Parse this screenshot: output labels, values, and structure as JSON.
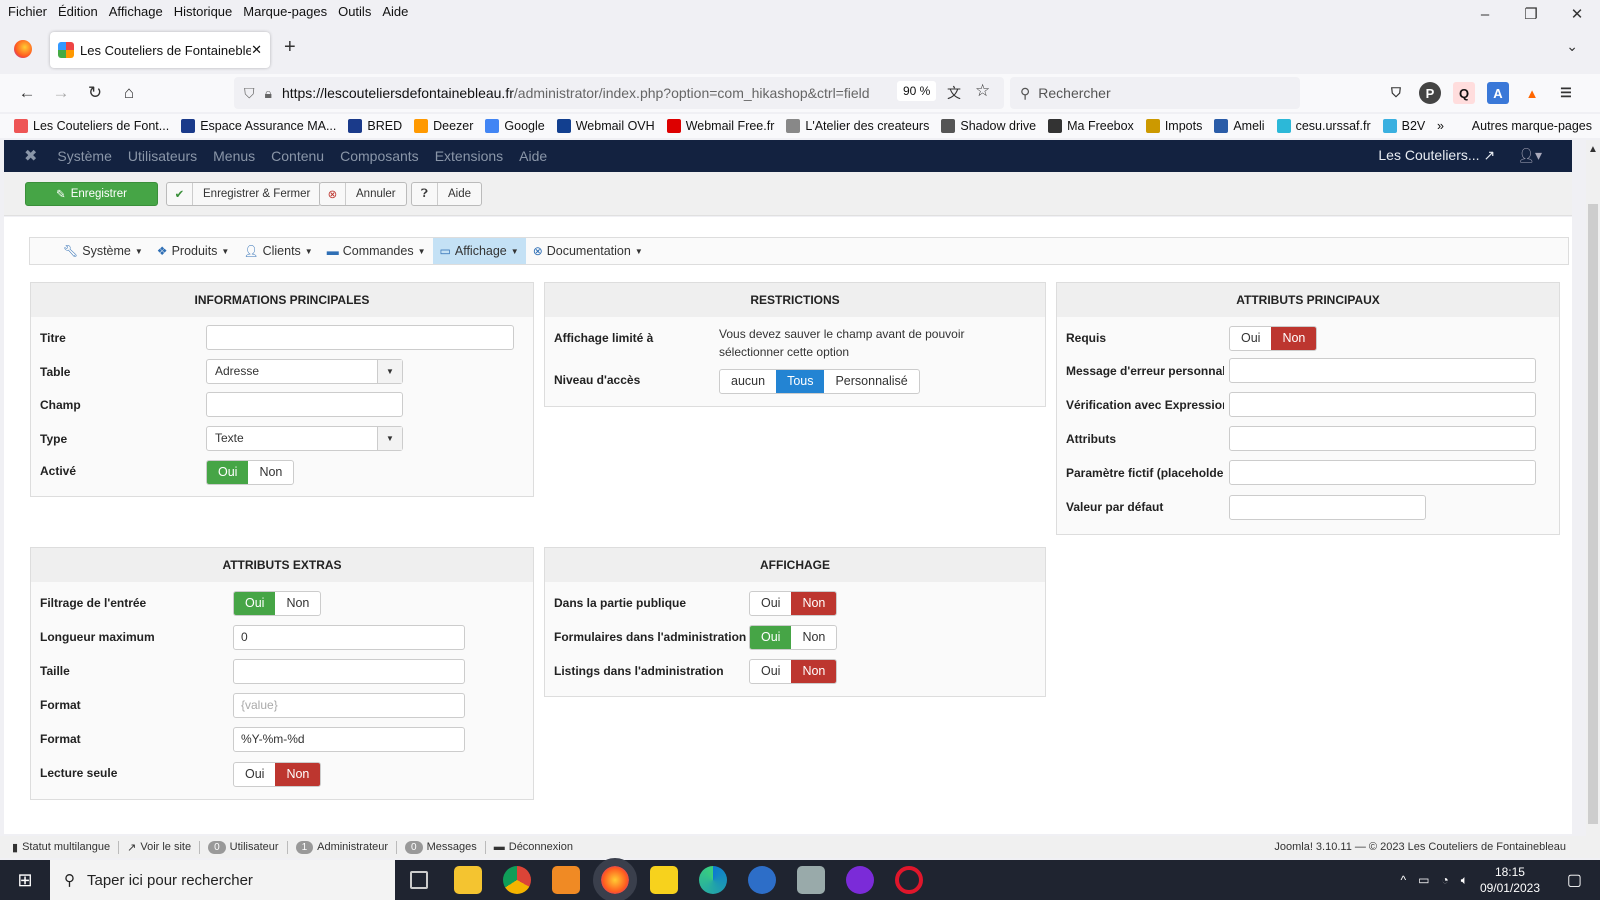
{
  "menubar": [
    "Fichier",
    "Édition",
    "Affichage",
    "Historique",
    "Marque-pages",
    "Outils",
    "Aide"
  ],
  "tab": {
    "title": "Les Couteliers de Fontainebleau"
  },
  "nav": {
    "url_host": "https://lescouteliersdefontainebleau.fr",
    "url_path": "/administrator/index.php?option=com_hikashop&ctrl=field",
    "zoom": "90 %",
    "search_placeholder": "Rechercher"
  },
  "bookmarks": [
    {
      "label": "Les Couteliers de Font...",
      "color": "#e55"
    },
    {
      "label": "Espace Assurance MA...",
      "color": "#1a3a8a"
    },
    {
      "label": "BRED",
      "color": "#1a3a8a"
    },
    {
      "label": "Deezer",
      "color": "#f90"
    },
    {
      "label": "Google",
      "color": "#4285f4"
    },
    {
      "label": "Webmail OVH",
      "color": "#123f8f"
    },
    {
      "label": "Webmail Free.fr",
      "color": "#d00"
    },
    {
      "label": "L'Atelier des createurs",
      "color": "#888"
    },
    {
      "label": "Shadow drive",
      "color": "#555"
    },
    {
      "label": "Ma Freebox",
      "color": "#333"
    },
    {
      "label": "Impots",
      "color": "#c90"
    },
    {
      "label": "Ameli",
      "color": "#2a5ca8"
    },
    {
      "label": "cesu.urssaf.fr",
      "color": "#2cb8d8"
    },
    {
      "label": "B2V",
      "color": "#3ab0e0"
    }
  ],
  "bookmarks_other": "Autres marque-pages",
  "joomla_menu": [
    "Système",
    "Utilisateurs",
    "Menus",
    "Contenu",
    "Composants",
    "Extensions",
    "Aide"
  ],
  "joomla_site": "Les Couteliers...",
  "toolbar": {
    "save": "Enregistrer",
    "save_close": "Enregistrer & Fermer",
    "cancel": "Annuler",
    "help": "Aide"
  },
  "submenu": [
    {
      "label": "Système",
      "icon": "wrench-icon"
    },
    {
      "label": "Produits",
      "icon": "cubes-icon"
    },
    {
      "label": "Clients",
      "icon": "user-icon"
    },
    {
      "label": "Commandes",
      "icon": "credit-card-icon"
    },
    {
      "label": "Affichage",
      "icon": "monitor-icon"
    },
    {
      "label": "Documentation",
      "icon": "lifebuoy-icon"
    }
  ],
  "info": {
    "title": "INFORMATIONS PRINCIPALES",
    "titre": "Titre",
    "table": "Table",
    "table_value": "Adresse",
    "champ": "Champ",
    "type": "Type",
    "type_value": "Texte",
    "active": "Activé"
  },
  "restrictions": {
    "title": "RESTRICTIONS",
    "limited": "Affichage limité à",
    "limited_msg": "Vous devez sauver le champ avant de pouvoir sélectionner cette option",
    "access": "Niveau d'accès",
    "access_options": [
      "aucun",
      "Tous",
      "Personnalisé"
    ]
  },
  "attributs": {
    "title": "ATTRIBUTS PRINCIPAUX",
    "requis": "Requis",
    "msg": "Message d'erreur personnalisé",
    "regex": "Vérification avec Expression régulière",
    "attrs": "Attributs",
    "placeholder": "Paramètre fictif (placeholder)",
    "default": "Valeur par défaut"
  },
  "extras": {
    "title": "ATTRIBUTS EXTRAS",
    "filter": "Filtrage de l'entrée",
    "maxlen": "Longueur maximum",
    "maxlen_value": "0",
    "size": "Taille",
    "format1": "Format",
    "format1_placeholder": "{value}",
    "format2": "Format",
    "format2_value": "%Y-%m-%d",
    "readonly": "Lecture seule"
  },
  "affichage": {
    "title": "AFFICHAGE",
    "public": "Dans la partie publique",
    "forms": "Formulaires dans l'administration",
    "listings": "Listings dans l'administration"
  },
  "yes": "Oui",
  "no": "Non",
  "status": {
    "multilang": "Statut multilangue",
    "view_site": "Voir le site",
    "users_count": "0",
    "users": "Utilisateur",
    "admins_count": "1",
    "admins": "Administrateur",
    "messages_count": "0",
    "messages": "Messages",
    "logout": "Déconnexion",
    "version": "Joomla! 3.10.11  —  © 2023 Les Couteliers de Fontainebleau"
  },
  "taskbar": {
    "search": "Taper ici pour rechercher",
    "time": "18:15",
    "date": "09/01/2023"
  }
}
